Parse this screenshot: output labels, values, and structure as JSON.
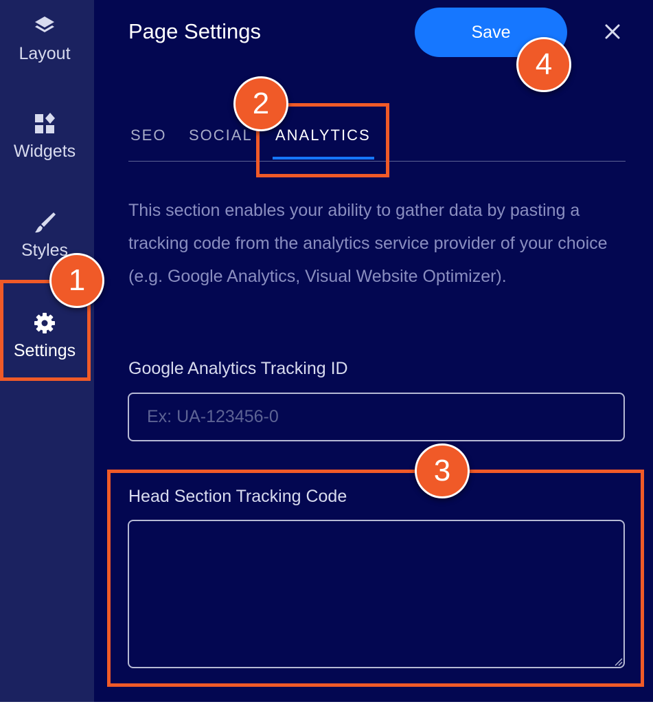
{
  "sidebar": {
    "items": [
      {
        "label": "Layout",
        "icon": "layers-icon"
      },
      {
        "label": "Widgets",
        "icon": "widgets-icon"
      },
      {
        "label": "Styles",
        "icon": "brush-icon"
      },
      {
        "label": "Settings",
        "icon": "gear-icon",
        "active": true
      }
    ]
  },
  "header": {
    "title": "Page Settings",
    "save_label": "Save",
    "close_icon": "close-icon"
  },
  "tabs": [
    {
      "label": "SEO"
    },
    {
      "label": "SOCIAL"
    },
    {
      "label": "ANALYTICS",
      "active": true
    }
  ],
  "description": "This section enables your ability to gather data by pasting a tracking code from the analytics service provider of your choice (e.g. Google Analytics, Visual Website Optimizer).",
  "fields": {
    "tracking_id": {
      "label": "Google Analytics Tracking ID",
      "placeholder": "Ex: UA-123456-0",
      "value": ""
    },
    "head_code": {
      "label": "Head Section Tracking Code",
      "value": ""
    }
  },
  "callouts": [
    "1",
    "2",
    "3",
    "4"
  ],
  "colors": {
    "panel": "#030751",
    "sidebar": "#1b2260",
    "accent": "#1677ff",
    "callout": "#f05a28"
  }
}
